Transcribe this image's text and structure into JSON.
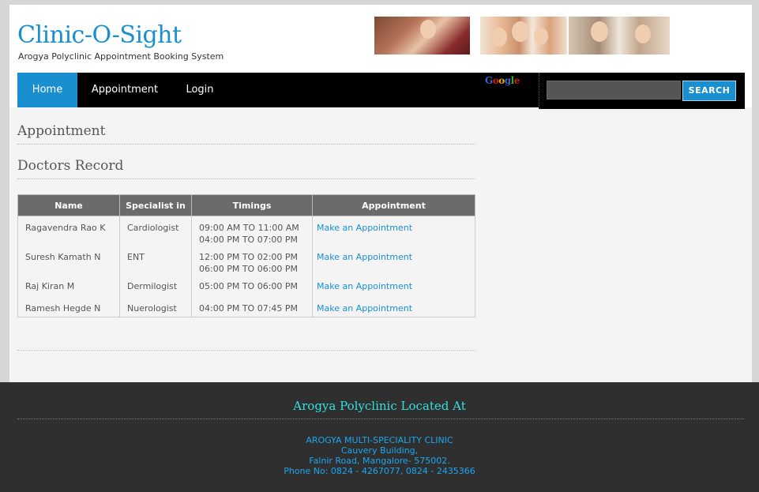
{
  "header": {
    "brand": "Clinic-O-Sight",
    "tagline": "Arogya Polyclinic Appointment Booking System"
  },
  "nav": {
    "items": [
      {
        "label": "Home"
      },
      {
        "label": "Appointment"
      },
      {
        "label": "Login"
      }
    ],
    "active": "Home",
    "google_logo": "Google"
  },
  "search": {
    "value": "",
    "button_label": "SEARCH"
  },
  "main": {
    "heading_appointment": "Appointment",
    "heading_doctors": "Doctors Record",
    "table": {
      "columns": [
        "Name",
        "Specialist in",
        "Timings",
        "Appointment"
      ],
      "rows": [
        {
          "name": "Ragavendra Rao K",
          "specialty": "Cardiologist",
          "timing1": "09:00 AM TO 11:00 AM",
          "timing2": "04:00 PM TO 07:00 PM",
          "link": "Make an Appointment"
        },
        {
          "name": "Suresh Kamath N",
          "specialty": "ENT",
          "timing1": "12:00 PM TO 02:00 PM",
          "timing2": "06:00 PM TO 06:00 PM",
          "link": "Make an Appointment"
        },
        {
          "name": "Raj Kiran M",
          "specialty": "Dermilogist",
          "timing1": "05:00 PM TO 06:00 PM",
          "timing2": "",
          "link": "Make an Appointment"
        },
        {
          "name": "Ramesh Hegde N",
          "specialty": "Nuerologist",
          "timing1": "04:00 PM TO 07:45 PM",
          "timing2": "",
          "link": "Make an Appointment"
        }
      ]
    }
  },
  "footer": {
    "title": "Arogya Polyclinic Located At",
    "address_lines": [
      "AROGYA MULTI-SPECIALITY CLINIC",
      "Cauvery Building,",
      "Falnir Road, Mangalore- 575002.",
      "Phone No: 0824 - 4267077, 0824 - 2435366"
    ]
  },
  "colors": {
    "accent": "#1a8fd0",
    "nav_bg": "#000000",
    "footer_bg": "#2f2f2f",
    "footer_title": "#34e0e0"
  }
}
